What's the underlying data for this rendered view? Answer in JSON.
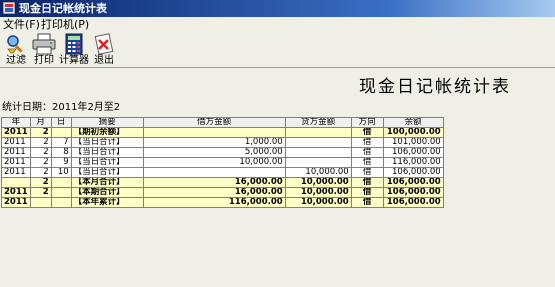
{
  "window": {
    "title": "现金日记帐统计表"
  },
  "menu": [
    {
      "label": "文件(F)"
    },
    {
      "label": "打印机(P)"
    }
  ],
  "toolbar": [
    {
      "label": "过滤",
      "icon": "filter-icon"
    },
    {
      "label": "打印",
      "icon": "printer-icon"
    },
    {
      "label": "计算器",
      "icon": "calculator-icon"
    },
    {
      "label": "退出",
      "icon": "exit-icon"
    }
  ],
  "report": {
    "title": "现金日记帐统计表",
    "date_label": "统计日期：2011年2月至2"
  },
  "table": {
    "headers": [
      "年",
      "月",
      "日",
      "摘要",
      "借方金额",
      "贷方金额",
      "方向",
      "余额"
    ],
    "rows": [
      [
        "2011",
        "2",
        "",
        "【期初余额】",
        "",
        "",
        "借",
        "100,000.00"
      ],
      [
        "2011",
        "2",
        "7",
        "【当日合计】",
        "1,000.00",
        "",
        "借",
        "101,000.00"
      ],
      [
        "2011",
        "2",
        "8",
        "【当日合计】",
        "5,000.00",
        "",
        "借",
        "106,000.00"
      ],
      [
        "2011",
        "2",
        "9",
        "【当日合计】",
        "10,000.00",
        "",
        "借",
        "116,000.00"
      ],
      [
        "2011",
        "2",
        "10",
        "【当日合计】",
        "",
        "10,000.00",
        "借",
        "106,000.00"
      ],
      [
        "",
        "2",
        "",
        "【本月合计】",
        "16,000.00",
        "10,000.00",
        "借",
        "106,000.00"
      ],
      [
        "2011",
        "2",
        "",
        "【本期合计】",
        "16,000.00",
        "10,000.00",
        "借",
        "106,000.00"
      ],
      [
        "2011",
        "",
        "",
        "【本年累计】",
        "116,000.00",
        "10,000.00",
        "借",
        "106,000.00"
      ]
    ]
  }
}
